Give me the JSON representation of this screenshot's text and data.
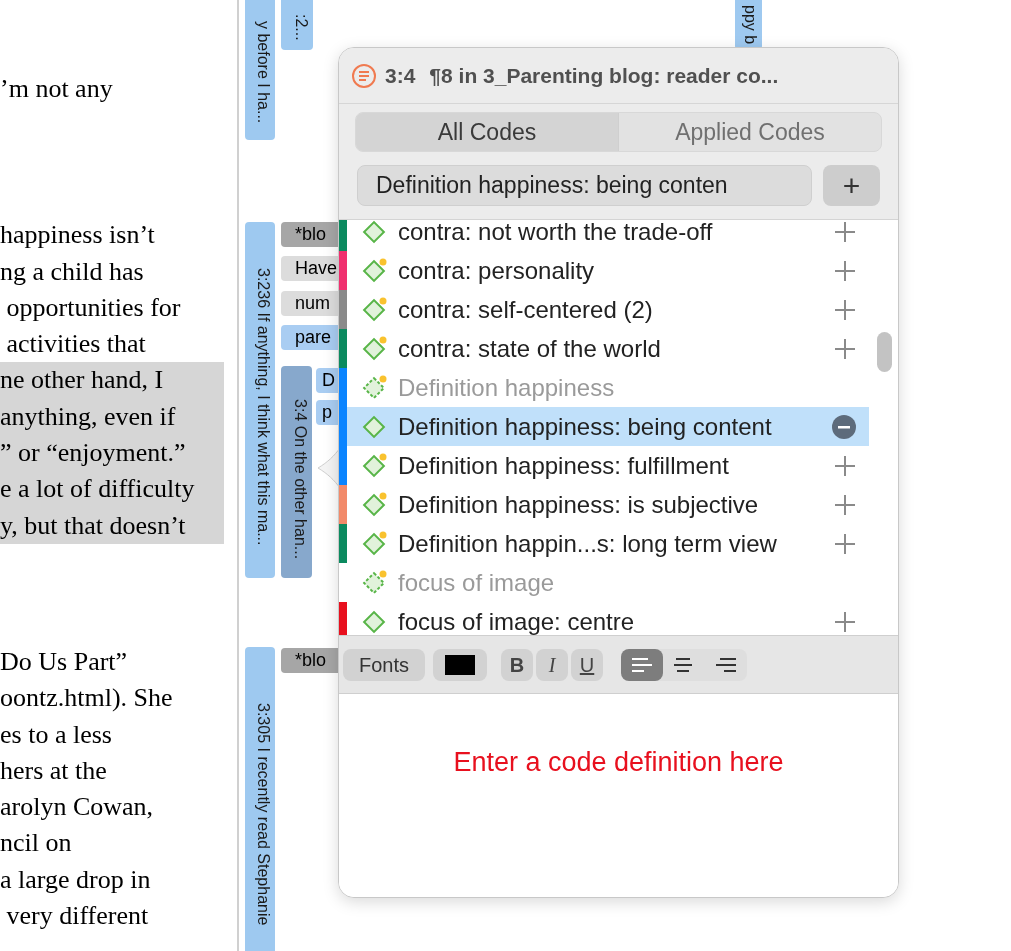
{
  "document": {
    "paragraphs": [
      {
        "lines": [
          {
            "text": "’m not any",
            "highlighted": false
          }
        ]
      },
      {
        "lines": [
          {
            "text": "happiness isn’t",
            "highlighted": false
          },
          {
            "text": "ng a child has",
            "highlighted": false
          },
          {
            "text": " opportunities for",
            "highlighted": false
          },
          {
            "text": " activities that",
            "highlighted": false
          },
          {
            "text": "ne other hand, I",
            "highlighted": true
          },
          {
            "text": "anything, even if",
            "highlighted": true
          },
          {
            "text": "” or “enjoyment.”",
            "highlighted": true
          },
          {
            "text": "e a lot of difficulty",
            "highlighted": true
          },
          {
            "text": "y, but that doesn’t",
            "highlighted": true
          }
        ]
      },
      {
        "lines": [
          {
            "text": "Do Us Part”",
            "highlighted": false
          },
          {
            "text": "oontz.html). She",
            "highlighted": false
          },
          {
            "text": "es to a less",
            "highlighted": false
          },
          {
            "text": "hers at the",
            "highlighted": false
          },
          {
            "text": "arolyn Cowan,",
            "highlighted": false
          },
          {
            "text": "ncil on",
            "highlighted": false
          },
          {
            "text": "a large drop in",
            "highlighted": false
          },
          {
            "text": " very different",
            "highlighted": false
          }
        ]
      }
    ]
  },
  "margin": {
    "quotations": [
      {
        "label": "y before I ha...",
        "selected": false
      },
      {
        "label": ":2...",
        "selected": false
      },
      {
        "label": "3:236 If anything, I think what this ma...",
        "selected": false
      },
      {
        "label": "3:4 On the other han...",
        "selected": true
      },
      {
        "label": "3:305 I recently read Stephanie",
        "selected": false
      },
      {
        "label": "ppy b",
        "selected": false
      }
    ],
    "tags": [
      {
        "label": "*blo",
        "color": "#a6a6a6"
      },
      {
        "label": "Have",
        "color": "#dcdcdc"
      },
      {
        "label": "num",
        "color": "#dcdcdc"
      },
      {
        "label": "pare",
        "color": "#a9cdf2"
      },
      {
        "label": "D",
        "color": "#a9cdf2"
      },
      {
        "label": "p",
        "color": "#a9cdf2"
      },
      {
        "label": "*blo",
        "color": "#a6a6a6"
      }
    ]
  },
  "popover": {
    "title_id": "3:4",
    "title": "¶8 in 3_Parenting blog: reader co...",
    "tabs": [
      {
        "label": "All Codes",
        "selected": true
      },
      {
        "label": "Applied Codes",
        "selected": false
      }
    ],
    "search": {
      "value": "Definition happiness: being conten"
    },
    "add_button": "+",
    "codes": [
      {
        "kind": "code",
        "label": "contra: not worth the trade-off",
        "color": "#0b8a5f",
        "memo": false,
        "applied": false,
        "selected": false
      },
      {
        "kind": "code",
        "label": "contra: personality",
        "color": "#f0306f",
        "memo": true,
        "applied": false,
        "selected": false
      },
      {
        "kind": "code",
        "label": "contra: self-centered (2)",
        "color": "#8a8a8a",
        "memo": true,
        "applied": false,
        "selected": false
      },
      {
        "kind": "code",
        "label": "contra: state of the world",
        "color": "#0b8a5f",
        "memo": true,
        "applied": false,
        "selected": false
      },
      {
        "kind": "group",
        "label": "Definition happiness",
        "color": "#0a84ff",
        "memo": true,
        "selected": false
      },
      {
        "kind": "code",
        "label": "Definition happiness: being content",
        "color": "#0a84ff",
        "memo": false,
        "applied": true,
        "selected": true
      },
      {
        "kind": "code",
        "label": "Definition happiness: fulfillment",
        "color": "#0a84ff",
        "memo": true,
        "applied": false,
        "selected": false
      },
      {
        "kind": "code",
        "label": "Definition happiness: is subjective",
        "color": "#f28a6a",
        "memo": true,
        "applied": false,
        "selected": false
      },
      {
        "kind": "code",
        "label": "Definition happin...s: long term view",
        "color": "#0b8a5f",
        "memo": true,
        "applied": false,
        "selected": false
      },
      {
        "kind": "group",
        "label": "focus of image",
        "memo": true,
        "selected": false
      },
      {
        "kind": "code",
        "label": "focus of image: centre",
        "color": "#e8101e",
        "memo": false,
        "applied": false,
        "selected": false
      }
    ],
    "toolbar": {
      "fonts": "Fonts",
      "color_well": {
        "color": "#000000"
      },
      "bold": "B",
      "italic": "I",
      "underline": "U",
      "alignments": [
        {
          "kind": "left",
          "selected": true
        },
        {
          "kind": "center",
          "selected": false
        },
        {
          "kind": "right",
          "selected": false
        }
      ]
    },
    "definition": {
      "placeholder": "Enter a code definition here"
    }
  }
}
